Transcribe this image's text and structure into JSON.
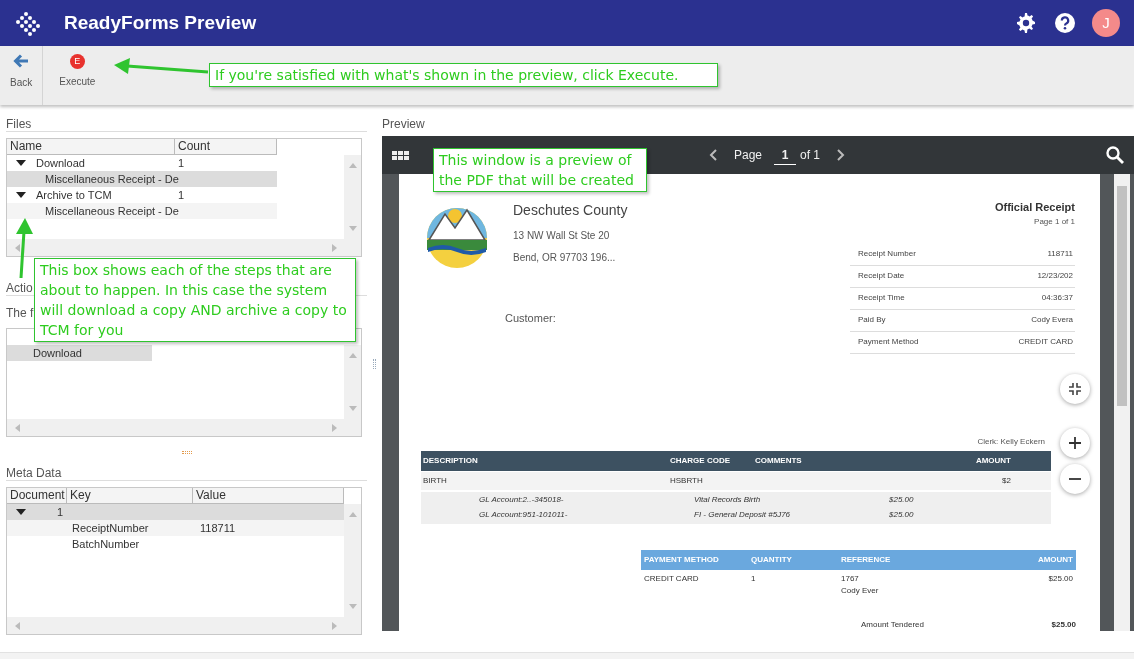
{
  "app": {
    "title": "ReadyForms Preview",
    "avatar": "J"
  },
  "toolbar": [
    {
      "kind": "back",
      "label": "Back"
    },
    {
      "kind": "execute",
      "label": "Execute",
      "badge": "E"
    }
  ],
  "callouts": [
    "If you're satisfied with what's shown in the preview, click Execute.",
    "This box shows each of the steps that are about to happen. In this case the system will download a copy AND archive a copy to TCM for you",
    "This window is a preview of the PDF that will be created"
  ],
  "files": {
    "title": "Files",
    "columns": [
      "Name",
      "Count"
    ],
    "groups": [
      {
        "name": "Download",
        "count": "1",
        "expanded": true,
        "children": [
          {
            "name": "Miscellaneous Receipt - De",
            "selected": true
          }
        ]
      },
      {
        "name": "Archive to TCM",
        "count": "1",
        "expanded": true,
        "children": [
          {
            "name": "Miscellaneous Receipt - De",
            "selected": false
          }
        ]
      }
    ]
  },
  "actions": {
    "title": "Actio",
    "subtitle": "The f",
    "rows": [
      {
        "name": "Download",
        "selected": true
      }
    ]
  },
  "meta": {
    "title": "Meta Data",
    "columns": [
      "Document",
      "Key",
      "Value"
    ],
    "groups": [
      {
        "document": "1",
        "expanded": true,
        "children": [
          {
            "key": "ReceiptNumber",
            "value": "118711"
          },
          {
            "key": "BatchNumber"
          }
        ]
      }
    ]
  },
  "preview": {
    "title": "Preview",
    "page_label": "Page",
    "page": "1",
    "page_total": "of 1",
    "document": {
      "county": "Deschutes County",
      "address": [
        "13 NW Wall St Ste 20",
        "Bend, OR 97703 196..."
      ],
      "receipt_title": "Official Receipt",
      "page_note": "Page 1 of 1",
      "info": [
        {
          "label": "Receipt Number",
          "value": "118711"
        },
        {
          "label": "Receipt Date",
          "value": "12/23/202"
        },
        {
          "label": "Receipt Time",
          "value": "04:36:37"
        },
        {
          "label": "Paid By",
          "value": "Cody Evera"
        },
        {
          "label": "Payment Method",
          "value": "CREDIT CARD"
        }
      ],
      "customer": "Customer:",
      "clerk": "Clerk: Kelly Eckern",
      "items": {
        "columns": [
          "DESCRIPTION",
          "CHARGE CODE",
          "COMMENTS",
          "AMOUNT"
        ],
        "row": [
          "BIRTH",
          "HSBRTH",
          "$2"
        ],
        "gl": [
          [
            "GL Account:2..-345018-",
            "Vital Records Birth",
            "$25.00"
          ],
          [
            "GL Account:951-101011-",
            "FI - General Deposit #5J76",
            "$25.00"
          ]
        ]
      },
      "payments": {
        "columns": [
          "PAYMENT METHOD",
          "QUANTITY",
          "REFERENCE",
          "AMOUNT"
        ],
        "row": [
          "CREDIT CARD",
          "1",
          "1767",
          "$25.00"
        ],
        "row_note": "Cody Ever"
      },
      "tendered": {
        "label": "Amount Tendered",
        "value": "$25.00"
      }
    }
  }
}
